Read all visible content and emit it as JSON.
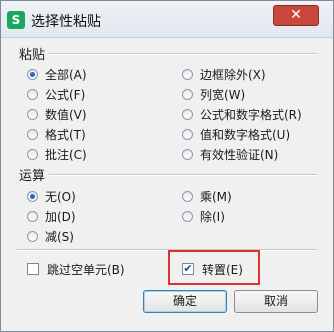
{
  "window": {
    "title": "选择性粘贴",
    "app_icon": "S",
    "close_label": "✕"
  },
  "paste": {
    "group_label": "粘贴",
    "options": [
      {
        "label": "全部(A)",
        "selected": true
      },
      {
        "label": "公式(F)",
        "selected": false
      },
      {
        "label": "数值(V)",
        "selected": false
      },
      {
        "label": "格式(T)",
        "selected": false
      },
      {
        "label": "批注(C)",
        "selected": false
      },
      {
        "label": "边框除外(X)",
        "selected": false
      },
      {
        "label": "列宽(W)",
        "selected": false
      },
      {
        "label": "公式和数字格式(R)",
        "selected": false
      },
      {
        "label": "值和数字格式(U)",
        "selected": false
      },
      {
        "label": "有效性验证(N)",
        "selected": false
      }
    ]
  },
  "operation": {
    "group_label": "运算",
    "options": [
      {
        "label": "无(O)",
        "selected": true
      },
      {
        "label": "加(D)",
        "selected": false
      },
      {
        "label": "减(S)",
        "selected": false
      },
      {
        "label": "乘(M)",
        "selected": false
      },
      {
        "label": "除(I)",
        "selected": false
      }
    ]
  },
  "checkboxes": {
    "skip_blanks": {
      "label": "跳过空单元(B)",
      "checked": false
    },
    "transpose": {
      "label": "转置(E)",
      "checked": true
    }
  },
  "buttons": {
    "ok": "确定",
    "cancel": "取消"
  },
  "colors": {
    "highlight": "#e03030",
    "app_icon": "#1aa660",
    "close": "#c8473d"
  }
}
